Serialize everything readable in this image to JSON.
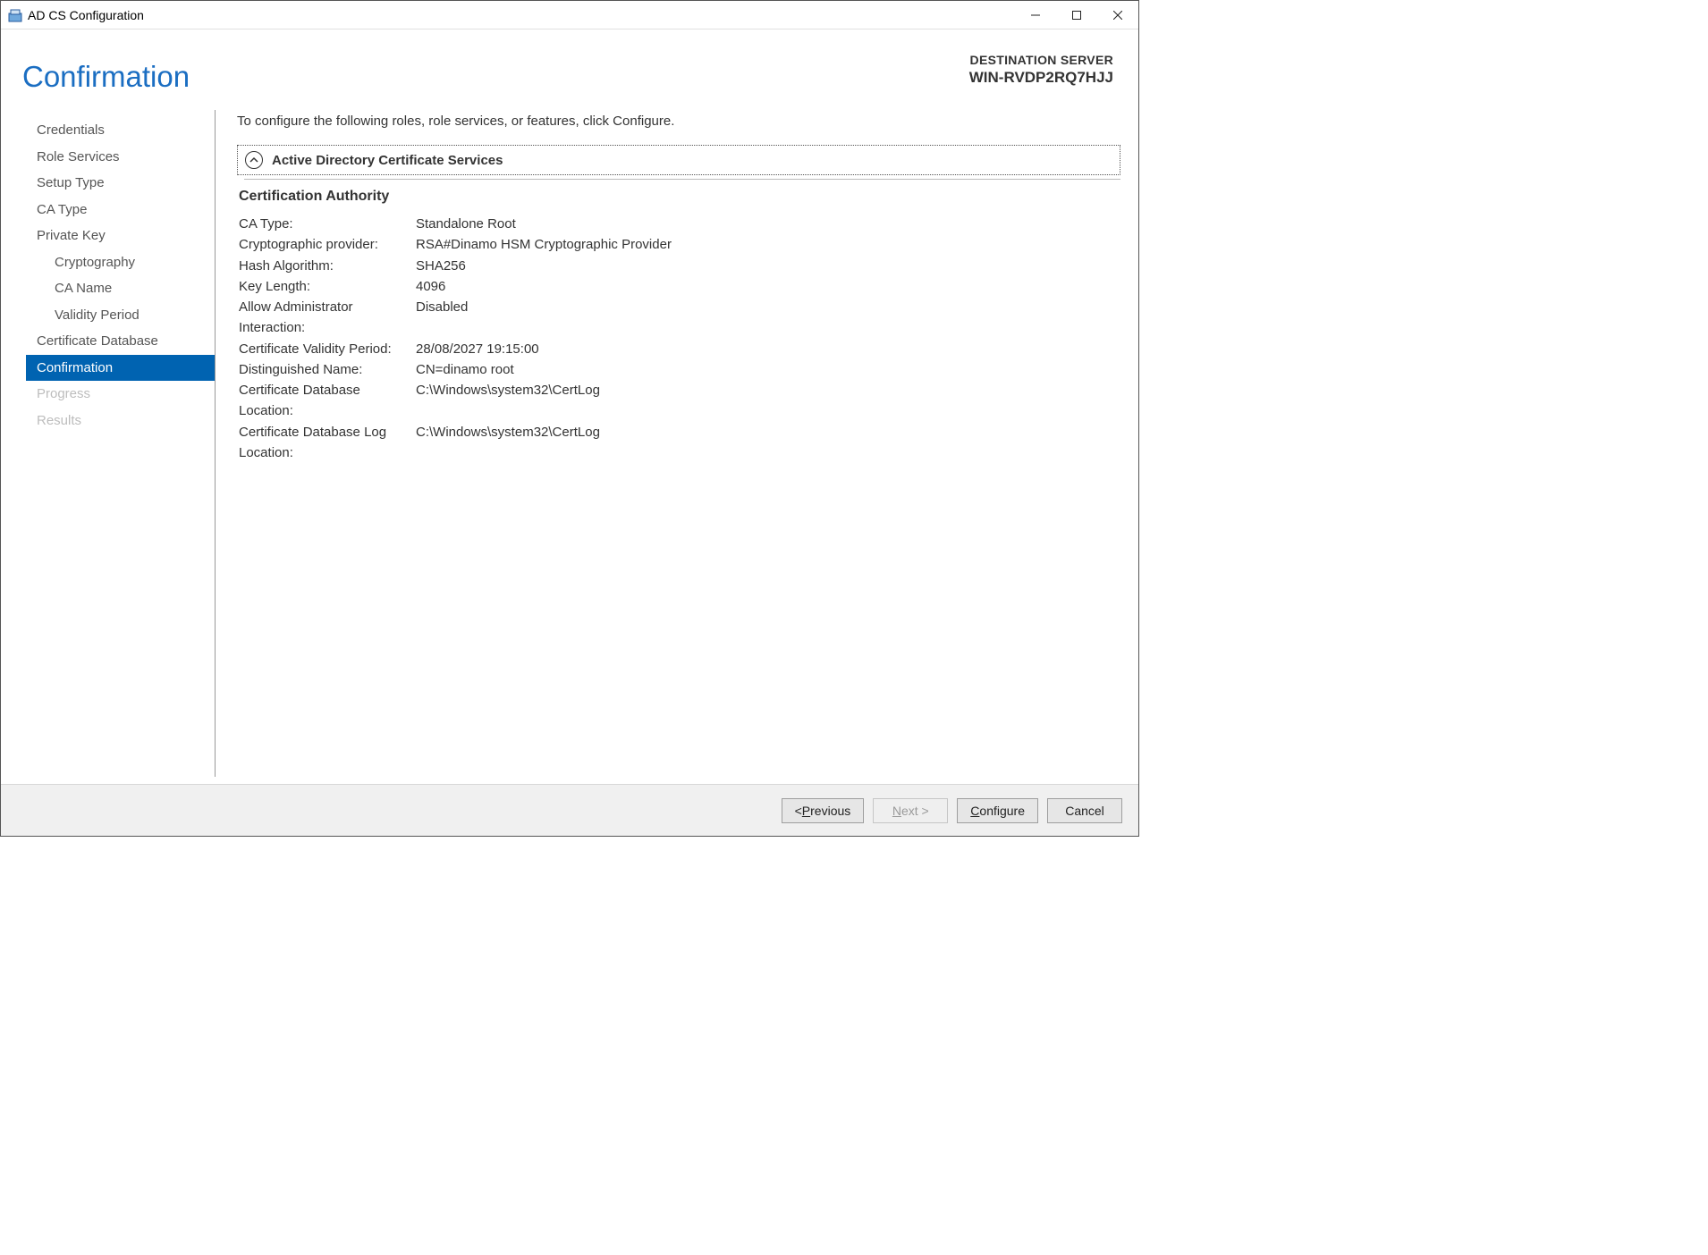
{
  "window": {
    "title": "AD CS Configuration"
  },
  "header": {
    "page_title": "Confirmation",
    "dest_label": "DESTINATION SERVER",
    "dest_name": "WIN-RVDP2RQ7HJJ"
  },
  "sidebar": {
    "items": [
      {
        "label": "Credentials",
        "indent": false,
        "state": "normal"
      },
      {
        "label": "Role Services",
        "indent": false,
        "state": "normal"
      },
      {
        "label": "Setup Type",
        "indent": false,
        "state": "normal"
      },
      {
        "label": "CA Type",
        "indent": false,
        "state": "normal"
      },
      {
        "label": "Private Key",
        "indent": false,
        "state": "normal"
      },
      {
        "label": "Cryptography",
        "indent": true,
        "state": "normal"
      },
      {
        "label": "CA Name",
        "indent": true,
        "state": "normal"
      },
      {
        "label": "Validity Period",
        "indent": true,
        "state": "normal"
      },
      {
        "label": "Certificate Database",
        "indent": false,
        "state": "normal"
      },
      {
        "label": "Confirmation",
        "indent": false,
        "state": "active"
      },
      {
        "label": "Progress",
        "indent": false,
        "state": "disabled"
      },
      {
        "label": "Results",
        "indent": false,
        "state": "disabled"
      }
    ]
  },
  "content": {
    "intro": "To configure the following roles, role services, or features, click Configure.",
    "collapse_title": "Active Directory Certificate Services",
    "section_title": "Certification Authority",
    "rows": [
      {
        "k": "CA Type:",
        "v": "Standalone Root"
      },
      {
        "k": "Cryptographic provider:",
        "v": "RSA#Dinamo HSM Cryptographic Provider"
      },
      {
        "k": "Hash Algorithm:",
        "v": "SHA256"
      },
      {
        "k": "Key Length:",
        "v": "4096"
      },
      {
        "k": "Allow Administrator Interaction:",
        "v": "Disabled"
      },
      {
        "k": "Certificate Validity Period:",
        "v": "28/08/2027 19:15:00"
      },
      {
        "k": "Distinguished Name:",
        "v": "CN=dinamo root"
      },
      {
        "k": "Certificate Database Location:",
        "v": "C:\\Windows\\system32\\CertLog"
      },
      {
        "k": "Certificate Database Log Location:",
        "v": "C:\\Windows\\system32\\CertLog"
      }
    ]
  },
  "footer": {
    "previous_prefix": "< ",
    "previous_ul": "P",
    "previous_rest": "revious",
    "next_ul": "N",
    "next_rest": "ext >",
    "configure_ul": "C",
    "configure_rest": "onfigure",
    "cancel": "Cancel"
  }
}
